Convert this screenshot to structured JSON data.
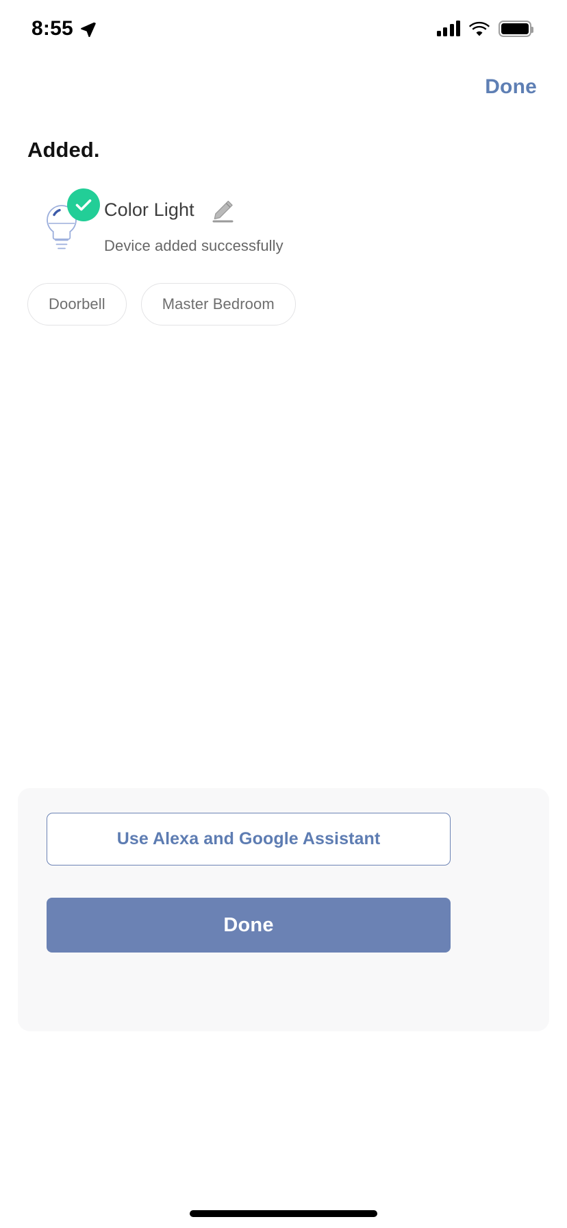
{
  "status_bar": {
    "time": "8:55",
    "location_icon": "location-arrow-icon",
    "cellular_icon": "cellular-signal-icon",
    "cellular_bars_filled": 4,
    "cellular_bars_total": 4,
    "wifi_icon": "wifi-icon",
    "battery_icon": "battery-full-icon",
    "battery_level_percent": 100
  },
  "nav": {
    "done_label": "Done",
    "done_color": "#5E7FB4"
  },
  "main": {
    "title": "Added.",
    "device": {
      "icon": "light-bulb-icon",
      "status_icon": "check-circle-icon",
      "status_color": "#22CE97",
      "name": "Color Light",
      "edit_icon": "pencil-edit-icon",
      "subtitle": "Device added successfully"
    },
    "room_chips": [
      {
        "label": "Doorbell"
      },
      {
        "label": "Master Bedroom"
      }
    ]
  },
  "bottom_panel": {
    "background": "#F8F8F9",
    "secondary_button": {
      "label": "Use Alexa and Google Assistant",
      "text_color": "#5D7CB2",
      "border_color": "#6B82B4"
    },
    "primary_button": {
      "label": "Done",
      "background": "#6B82B4",
      "text_color": "#FFFFFF"
    }
  },
  "home_indicator": "home-indicator-bar"
}
